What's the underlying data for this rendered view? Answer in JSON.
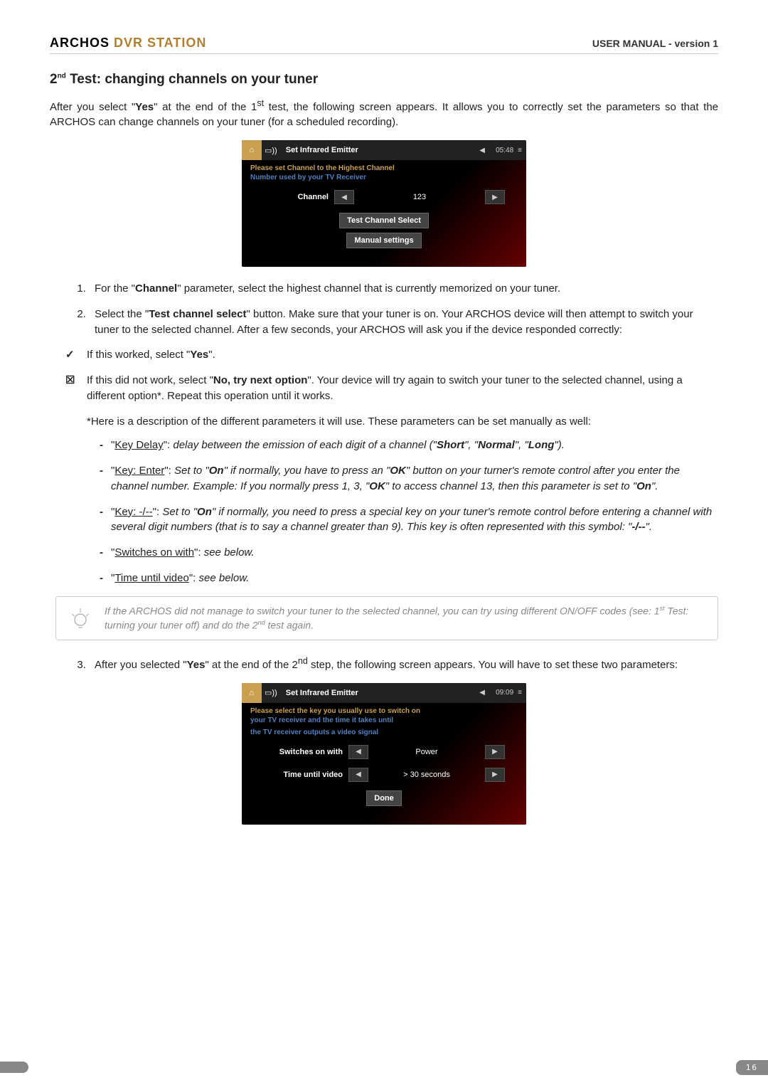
{
  "header": {
    "brand_a": "ARCHOS",
    "brand_dvr": " DVR STATION",
    "right": "USER MANUAL - version 1"
  },
  "title": {
    "prefix": "2",
    "sup": "nd",
    "rest": " Test: changing channels on your tuner"
  },
  "intro": {
    "p1a": "After you select \"",
    "p1b": "Yes",
    "p1c": "\" at the end of the 1",
    "p1sup": "st",
    "p1d": " test, the following screen appears. It allows you to correctly set the parameters so that the ARCHOS can change channels on your tuner (for a scheduled recording)."
  },
  "shot1": {
    "home": "⌂",
    "remote": "▭))",
    "title": "Set Infrared Emitter",
    "back": "◀",
    "time": "05:48",
    "menu": "≡",
    "warn": "Please set Channel to the Highest Channel",
    "sub": "Number used by your TV Receiver",
    "ch_label": "Channel",
    "ch_left": "◀",
    "ch_val": "123",
    "ch_right": "▶",
    "btn1": "Test Channel Select",
    "btn2": "Manual settings"
  },
  "ol1": {
    "li1a": "For the \"",
    "li1b": "Channel",
    "li1c": "\" parameter, select the highest channel that is currently memorized on your tuner.",
    "li2a": "Select the \"",
    "li2b": "Test channel select",
    "li2c": "\" button. Make sure that your tuner is on. Your ARCHOS device will then attempt to switch your tuner to the selected channel. After a few seconds, your ARCHOS will ask you if the device responded correctly:"
  },
  "check": {
    "ok_a": "If this worked, select \"",
    "ok_b": "Yes",
    "ok_c": "\".",
    "no_a": "If this did not work, select \"",
    "no_b": "No, try next option",
    "no_c": "\". Your device will try again to switch your tuner to the selected channel, using a different option*. Repeat this operation until it works."
  },
  "sub_p": "*Here is a description of the different parameters it will use. These parameters can be set manually as well:",
  "dash": {
    "d1_a": "\"",
    "d1_u": "Key Delay",
    "d1_b": "\": ",
    "d1_i1": "delay between the emission of each digit of a channel (\"",
    "d1_s": "Short",
    "d1_i2": "\", \"",
    "d1_n": "Normal",
    "d1_i3": "\", \"",
    "d1_l": "Long",
    "d1_i4": "\").",
    "d2_a": "\"",
    "d2_u": "Key: Enter",
    "d2_b": "\": ",
    "d2_i1": "Set to \"",
    "d2_on1": "On",
    "d2_i2": "\" if normally, you have to press an \"",
    "d2_ok1": "OK",
    "d2_i3": "\" button on your turner's remote control after you enter the channel number. Example: If you normally press 1, 3, \"",
    "d2_ok2": "OK",
    "d2_i4": "\" to access channel 13, then this parameter is set to \"",
    "d2_on2": "On",
    "d2_i5": "\".",
    "d3_a": "\"",
    "d3_u": "Key: -/--",
    "d3_b": "\": ",
    "d3_i1": "Set to \"",
    "d3_on": "On",
    "d3_i2": "\" if normally, you need to press a special key on your tuner's remote control before entering a channel with several digit numbers (that is to say a channel greater than 9). This key is often represented with this symbol: \"",
    "d3_sym": "-/--",
    "d3_i3": "\".",
    "d4_a": "\"",
    "d4_u": "Switches on with",
    "d4_b": "\": ",
    "d4_i": "see below.",
    "d5_a": "\"",
    "d5_u": "Time until video",
    "d5_b": "\": ",
    "d5_i": "see below."
  },
  "tip": {
    "t1": "If the ARCHOS did not manage to switch your tuner to the selected channel, you can try using different ON/OFF codes (see: 1",
    "t1sup": "st",
    "t2": " Test: turning your tuner off) and do the 2",
    "t2sup": "nd",
    "t3": " test again."
  },
  "ol2": {
    "li3a": "After you selected \"",
    "li3b": "Yes",
    "li3c": "\" at the end of the 2",
    "li3sup": "nd",
    "li3d": " step, the following screen appears. You will have to set these two parameters:"
  },
  "shot2": {
    "home": "⌂",
    "remote": "▭))",
    "title": "Set Infrared Emitter",
    "back": "◀",
    "time": "09:09",
    "menu": "≡",
    "warn": "Please select the key you usually use to switch on",
    "sub1": "your TV receiver and the time it takes until",
    "sub2": "the TV receiver outputs a video signal",
    "r1_label": "Switches on with",
    "r1_left": "◀",
    "r1_val": "Power",
    "r1_right": "▶",
    "r2_label": "Time until video",
    "r2_left": "◀",
    "r2_val": "> 30 seconds",
    "r2_right": "▶",
    "btn": "Done"
  },
  "footer": {
    "page": "16"
  }
}
